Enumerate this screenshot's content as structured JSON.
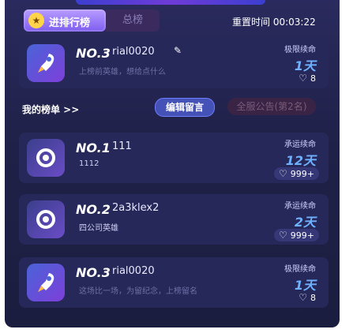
{
  "header": {
    "tab_active_label": "进排行榜",
    "tab_inactive_label": "总榜",
    "reset_text": "重置时间 00:03:22"
  },
  "my_card": {
    "rank": "NO.3",
    "name": "rial0020",
    "desc": "上榜前英雄，想给点什么",
    "tag": "极限续命",
    "days": "1天",
    "likes": "8"
  },
  "strip": {
    "my_list_label": "我的榜单 >>",
    "edit_button": "编辑留言",
    "rank_badge": "全服公告(第2名)"
  },
  "list": [
    {
      "rank": "NO.1",
      "name": "111",
      "sub": "1112",
      "tag": "承运续命",
      "days": "12天",
      "likes": "999+"
    },
    {
      "rank": "NO.2",
      "name": "2a3klex2",
      "sub": "四公司英雄",
      "tag": "承运续命",
      "days": "2天",
      "likes": "999+"
    },
    {
      "rank": "NO.3",
      "name": "rial0020",
      "sub": "这场比一场，为留纪念，上榜留名",
      "tag": "极限续命",
      "days": "1天",
      "likes": "8"
    }
  ],
  "colors": {
    "accent": "#6fb0ff",
    "panel": "#1f2148",
    "tab": "#8b6df5"
  }
}
